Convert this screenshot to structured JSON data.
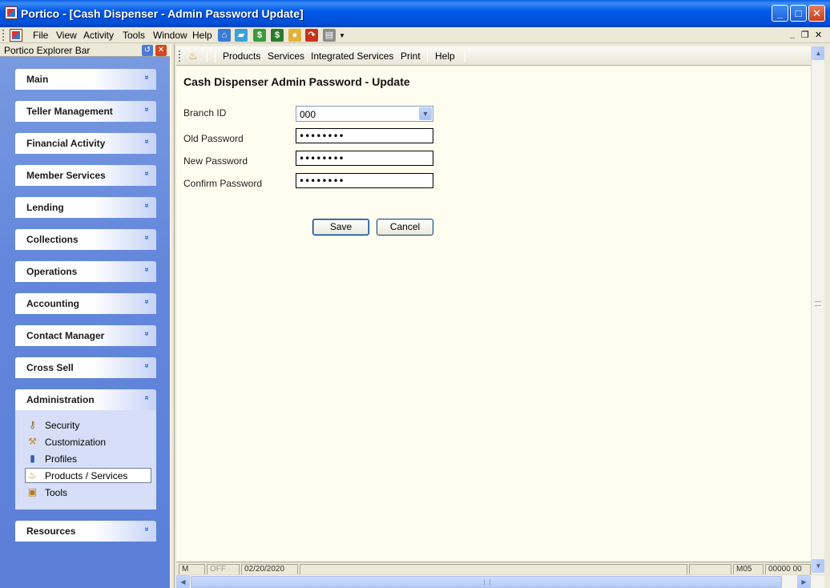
{
  "window": {
    "title": "Portico - [Cash Dispenser - Admin Password Update]",
    "minimize": "_",
    "maximize": "□",
    "close": "✕"
  },
  "menubar": {
    "items": [
      "File",
      "View",
      "Activity",
      "Tools",
      "Window",
      "Help"
    ],
    "mdi_minimize": "_",
    "mdi_restore": "❐",
    "mdi_close": "✕"
  },
  "explorer": {
    "title": "Portico Explorer Bar",
    "groups": [
      {
        "label": "Main",
        "chevron": "»"
      },
      {
        "label": "Teller Management",
        "chevron": "»"
      },
      {
        "label": "Financial Activity",
        "chevron": "»"
      },
      {
        "label": "Member Services",
        "chevron": "»"
      },
      {
        "label": "Lending",
        "chevron": "»"
      },
      {
        "label": "Collections",
        "chevron": "»"
      },
      {
        "label": "Operations",
        "chevron": "»"
      },
      {
        "label": "Accounting",
        "chevron": "»"
      },
      {
        "label": "Contact Manager",
        "chevron": "»"
      },
      {
        "label": "Cross Sell",
        "chevron": "»"
      },
      {
        "label": "Administration",
        "chevron": "«"
      },
      {
        "label": "Resources",
        "chevron": "»"
      }
    ],
    "admin_items": [
      {
        "label": "Security",
        "icon": "key-icon"
      },
      {
        "label": "Customization",
        "icon": "tools-icon"
      },
      {
        "label": "Profiles",
        "icon": "profile-icon"
      },
      {
        "label": "Products / Services",
        "icon": "products-icon",
        "selected": true
      },
      {
        "label": "Tools",
        "icon": "toolbox-icon"
      }
    ]
  },
  "content_toolbar": {
    "items": [
      "Products",
      "Services",
      "Integrated Services",
      "Print",
      "Help"
    ]
  },
  "form": {
    "title": "Cash Dispenser Admin Password - Update",
    "branch_label": "Branch ID",
    "branch_value": "000",
    "old_label": "Old Password",
    "old_value": "••••••••",
    "new_label": "New Password",
    "new_value": "••••••••",
    "confirm_label": "Confirm Password",
    "confirm_value": "••••••••",
    "save_label": "Save",
    "cancel_label": "Cancel"
  },
  "status": {
    "cells": [
      "M",
      "OFF",
      "02/20/2020",
      "",
      "",
      "M05",
      "00000 00"
    ]
  },
  "colors": {
    "titlebar": "#0058E6",
    "content_bg": "#FFFDEF",
    "explorer_bg": "#6487DC"
  }
}
